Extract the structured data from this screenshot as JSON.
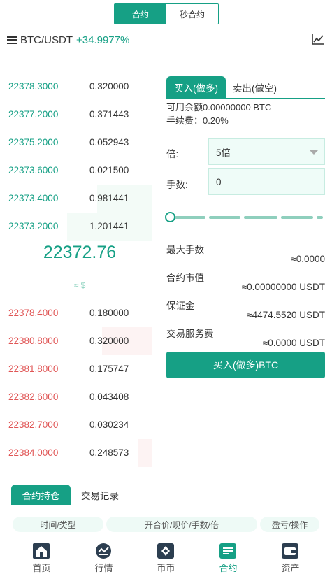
{
  "header": {
    "mode_tabs": [
      "合约",
      "秒合约"
    ],
    "pair": "BTC/USDT",
    "change": "+34.9977%",
    "menu_icon": "menu-icon",
    "chart_icon": "trend-chart-icon"
  },
  "order_book": {
    "sells": [
      {
        "price": "22378.3000",
        "qty": "0.320000",
        "depth": 0
      },
      {
        "price": "22377.2000",
        "qty": "0.371443",
        "depth": 0
      },
      {
        "price": "22375.2000",
        "qty": "0.052943",
        "depth": 0
      },
      {
        "price": "22373.6000",
        "qty": "0.021500",
        "depth": 0
      },
      {
        "price": "22373.4000",
        "qty": "0.981441",
        "depth": 0.65
      },
      {
        "price": "22373.2000",
        "qty": "1.201441",
        "depth": 1.0
      }
    ],
    "last_price": "22372.76",
    "approx_usd": "≈ $",
    "buys": [
      {
        "price": "22378.4000",
        "qty": "0.180000",
        "depth": 0
      },
      {
        "price": "22380.8000",
        "qty": "0.320000",
        "depth": 0.59
      },
      {
        "price": "22381.8000",
        "qty": "0.175747",
        "depth": 0
      },
      {
        "price": "22382.6000",
        "qty": "0.043408",
        "depth": 0
      },
      {
        "price": "22382.7000",
        "qty": "0.030234",
        "depth": 0
      },
      {
        "price": "22384.0000",
        "qty": "0.248573",
        "depth": 0.17
      }
    ]
  },
  "trade": {
    "buy_tab": "买入(做多)",
    "sell_tab": "卖出(做空)",
    "available": "可用余额0.00000000 BTC",
    "fee": "手续费：0.20%",
    "leverage_label": "倍:",
    "leverage_value": "5倍",
    "lots_label": "手数:",
    "lots_value": "0",
    "slider_position": 0,
    "max_lots_label": "最大手数",
    "max_lots_value": "≈0.0000",
    "market_value_label": "合约市值",
    "market_value_value": "≈0.00000000 USDT",
    "margin_label": "保证金",
    "margin_value": "≈4474.5520 USDT",
    "service_fee_label": "交易服务费",
    "service_fee_value": "≈0.0000 USDT",
    "submit_label": "买入(做多)BTC"
  },
  "positions": {
    "tab_active": "合约持仓",
    "tab_other": "交易记录",
    "columns": [
      "时间/类型",
      "开合价/现价/手数/倍",
      "盈亏/操作"
    ]
  },
  "bottom_nav": {
    "items": [
      {
        "label": "首页",
        "icon": "home-icon"
      },
      {
        "label": "行情",
        "icon": "market-icon"
      },
      {
        "label": "币币",
        "icon": "exchange-icon"
      },
      {
        "label": "合约",
        "icon": "contract-icon"
      },
      {
        "label": "资产",
        "icon": "wallet-icon"
      }
    ],
    "active_index": 3
  },
  "colors": {
    "accent": "#16a085",
    "sell_price": "#16a085",
    "buy_price": "#e05555"
  }
}
